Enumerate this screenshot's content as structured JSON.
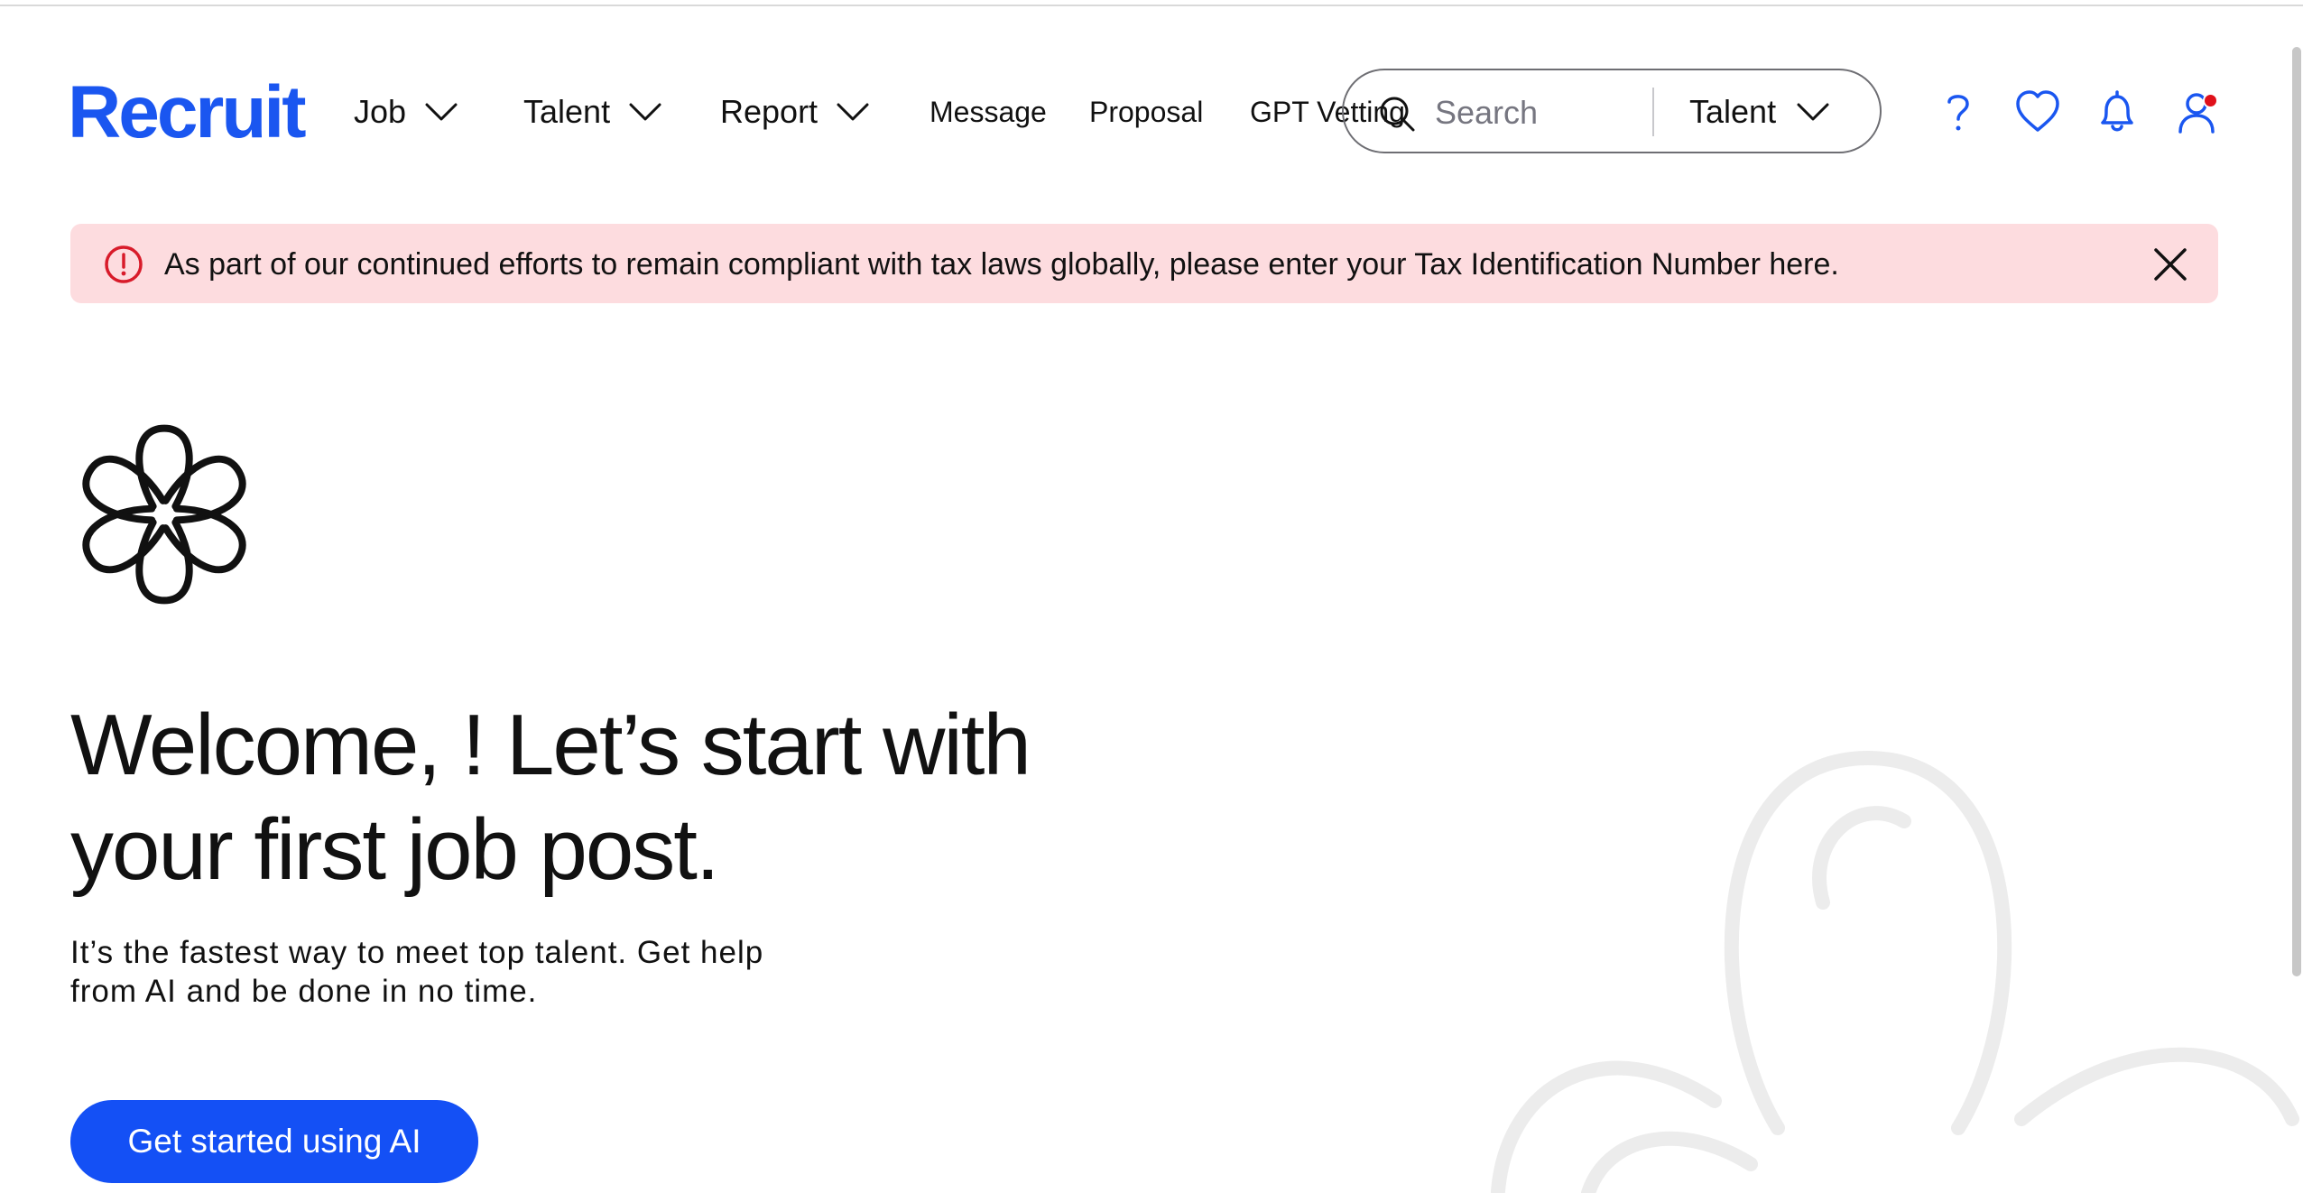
{
  "brand": {
    "name": "Recruit"
  },
  "nav": {
    "job": "Job",
    "talent": "Talent",
    "report": "Report",
    "message": "Message",
    "proposal": "Proposal",
    "gpt_vetting": "GPT Vetting"
  },
  "search": {
    "placeholder": "Search",
    "scope": "Talent"
  },
  "header_icons": [
    "help-icon",
    "heart-icon",
    "bell-icon",
    "user-icon"
  ],
  "alert": {
    "message": "As part of our continued efforts to remain compliant with tax laws globally, please enter your Tax Identification Number here."
  },
  "hero": {
    "title": "Welcome, ! Let’s start with your first job post.",
    "subtitle": "It’s the fastest way to meet top talent. Get help from AI and be done in no time.",
    "cta_label": "Get started using AI"
  },
  "colors": {
    "brand": "#1a56f0",
    "button": "#1450f5",
    "alert_bg": "#fddcdf",
    "alert_icon": "#d81b2a",
    "notification_dot": "#e0101a"
  }
}
